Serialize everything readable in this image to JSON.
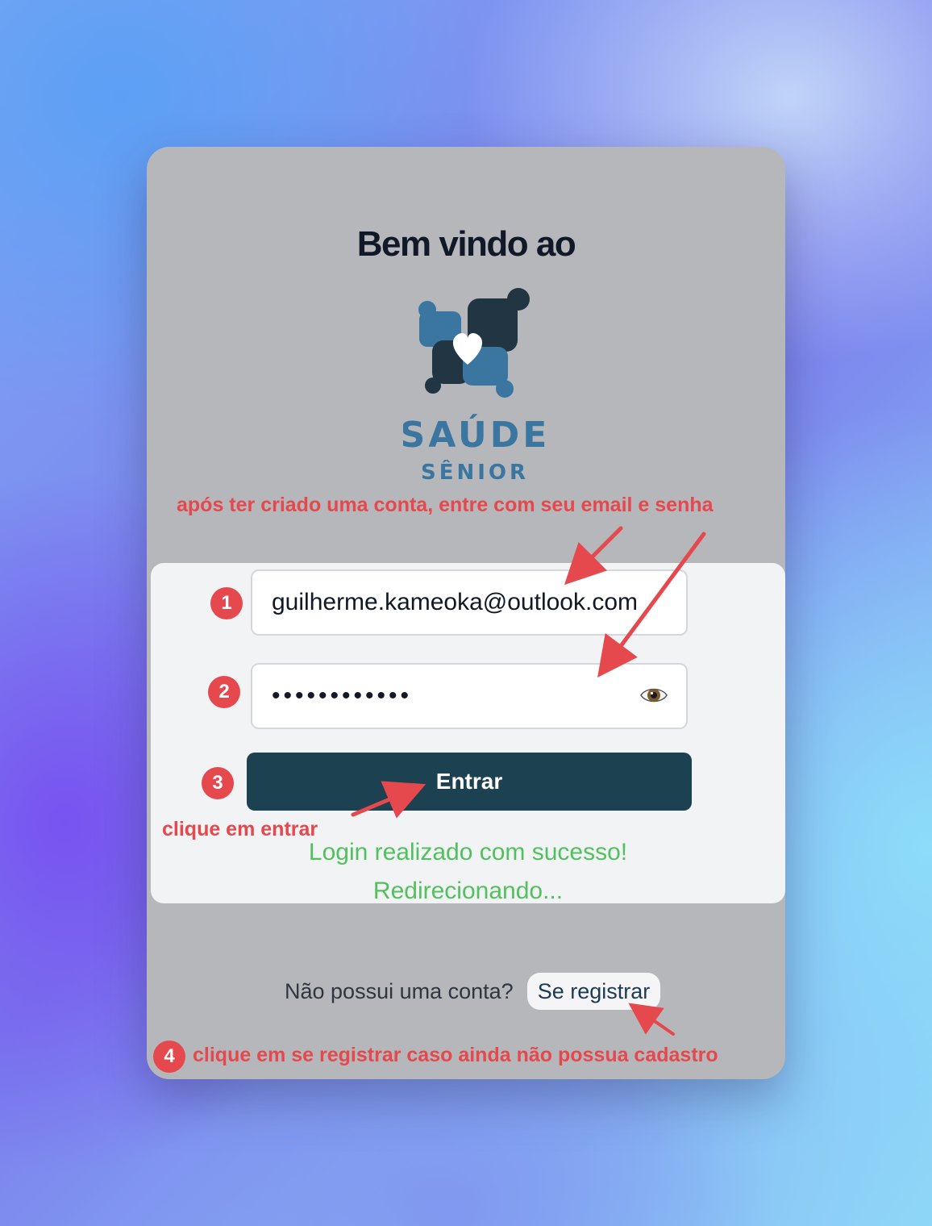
{
  "header": {
    "title": "Bem vindo ao"
  },
  "logo": {
    "line1": "SAÚDE",
    "line2": "SÊNIOR",
    "icon": "people-heart-logo-icon"
  },
  "annotations": {
    "top": "após ter criado uma conta, entre com seu email e senha",
    "click_enter": "clique em entrar",
    "click_register": "clique em se registrar caso ainda não possua cadastro"
  },
  "badges": [
    "1",
    "2",
    "3",
    "4"
  ],
  "form": {
    "email_value": "guilherme.kameoka@outlook.com",
    "password_masked": "••••••••••••",
    "show_password_icon": "eye-icon",
    "submit_label": "Entrar",
    "success_line1": "Login realizado com sucesso!",
    "success_line2": "Redirecionando..."
  },
  "footer": {
    "prompt": "Não possui uma conta?",
    "register_link": "Se registrar"
  },
  "colors": {
    "annotation_red": "#e5484d",
    "button_bg": "#1c4150",
    "success_green": "#53c05f",
    "card_bg": "#b6b7ba",
    "logo_blue": "#3a76a0",
    "logo_dark": "#213542"
  }
}
